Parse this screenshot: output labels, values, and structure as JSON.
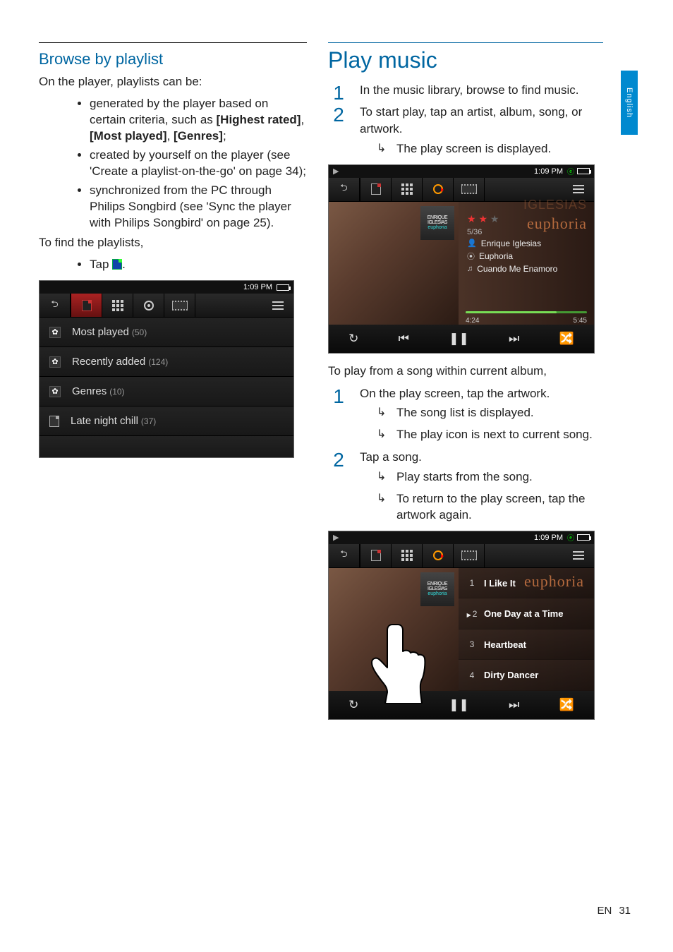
{
  "sideTab": "English",
  "footer": {
    "lang": "EN",
    "page": "31"
  },
  "left": {
    "heading": "Browse by playlist",
    "intro": "On the player, playlists can be:",
    "bullets": [
      {
        "pre": "generated by the player based on certain criteria, such as ",
        "b1": "[Highest rated]",
        "s1": ", ",
        "b2": "[Most played]",
        "s2": ", ",
        "b3": "[Genres]",
        "post": ";"
      },
      {
        "text": "created by yourself on the player (see 'Create a playlist-on-the-go' on page 34);"
      },
      {
        "text": "synchronized from the PC through Philips Songbird (see 'Sync the player with Philips Songbird' on page 25)."
      }
    ],
    "findHeading": "To find the playlists,",
    "tapLine": "Tap ",
    "tapPost": ".",
    "screenshot": {
      "time": "1:09 PM",
      "rows": [
        {
          "icon": "gear",
          "label": "Most played",
          "count": "(50)"
        },
        {
          "icon": "gear",
          "label": "Recently added",
          "count": "(124)"
        },
        {
          "icon": "gear",
          "label": "Genres",
          "count": "(10)"
        },
        {
          "icon": "doc",
          "label": "Late night chill",
          "count": "(37)"
        }
      ]
    }
  },
  "right": {
    "heading": "Play music",
    "steps1": [
      "In the music library, browse to find music.",
      "To start play, tap an artist, album, song, or artwork."
    ],
    "steps1Result": "The play screen is displayed.",
    "nowPlaying": {
      "time": "1:09 PM",
      "thumbL1": "ENRIQUE IGLESIAS",
      "thumbL2": "euphoria",
      "bgArtist": "IGLESIAS",
      "bgAlbum": "euphoria",
      "trackCount": "5/36",
      "artist": "Enrique Iglesias",
      "album": "Euphoria",
      "song": "Cuando Me Enamoro",
      "elapsed": "4:24",
      "total": "5:45"
    },
    "subHeading": "To play from a song within current album,",
    "steps2_1": "On the play screen, tap the artwork.",
    "steps2_1_results": [
      "The song list is displayed.",
      "The play icon is next to current song."
    ],
    "steps2_2": "Tap a song.",
    "steps2_2_results": [
      "Play starts from the song.",
      "To return to the play screen, tap the artwork again."
    ],
    "songList": {
      "time": "1:09 PM",
      "thumbL1": "ENRIQUE IGLESIAS",
      "thumbL2": "euphoria",
      "bgAlbum": "euphoria",
      "rows": [
        {
          "n": "1",
          "title": "I Like It",
          "playing": false
        },
        {
          "n": "2",
          "title": "One Day at a Time",
          "playing": true
        },
        {
          "n": "3",
          "title": "Heartbeat",
          "playing": false
        },
        {
          "n": "4",
          "title": "Dirty Dancer",
          "playing": false
        }
      ]
    }
  }
}
